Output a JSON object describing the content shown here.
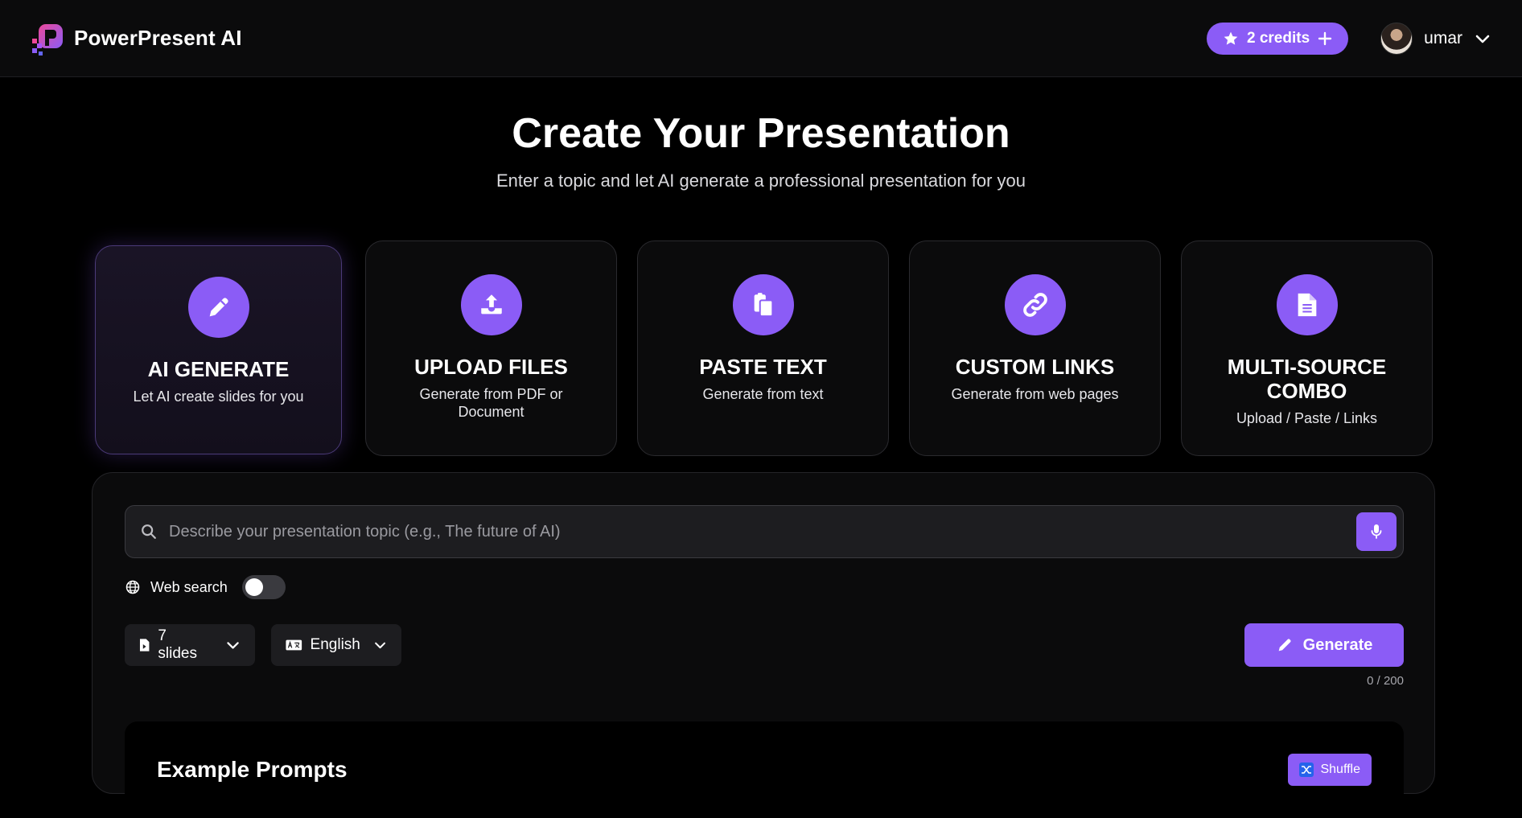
{
  "app": {
    "name": "PowerPresent AI"
  },
  "header": {
    "credits_label": "2 credits",
    "username": "umar"
  },
  "hero": {
    "title": "Create Your Presentation",
    "subtitle": "Enter a topic and let AI generate a professional presentation for you"
  },
  "modes": [
    {
      "title": "AI GENERATE",
      "desc": "Let AI create slides for you",
      "icon": "pencil-icon",
      "active": true
    },
    {
      "title": "UPLOAD FILES",
      "desc": "Generate from PDF or Document",
      "icon": "upload-icon",
      "active": false
    },
    {
      "title": "PASTE TEXT",
      "desc": "Generate from text",
      "icon": "paste-icon",
      "active": false
    },
    {
      "title": "CUSTOM LINKS",
      "desc": "Generate from web pages",
      "icon": "link-icon",
      "active": false
    },
    {
      "title": "MULTI-SOURCE COMBO",
      "desc": "Upload / Paste / Links",
      "icon": "document-icon",
      "active": false
    }
  ],
  "form": {
    "search_placeholder": "Describe your presentation topic (e.g., The future of AI)",
    "search_value": "",
    "web_search_label": "Web search",
    "web_search_enabled": false,
    "slides_label": "7 slides",
    "language_label": "English",
    "generate_label": "Generate",
    "char_counter": "0 / 200"
  },
  "examples": {
    "title": "Example Prompts",
    "shuffle_label": "Shuffle"
  },
  "colors": {
    "accent": "#8b5cf6",
    "background": "#000000",
    "panel": "#0b0b0c"
  }
}
